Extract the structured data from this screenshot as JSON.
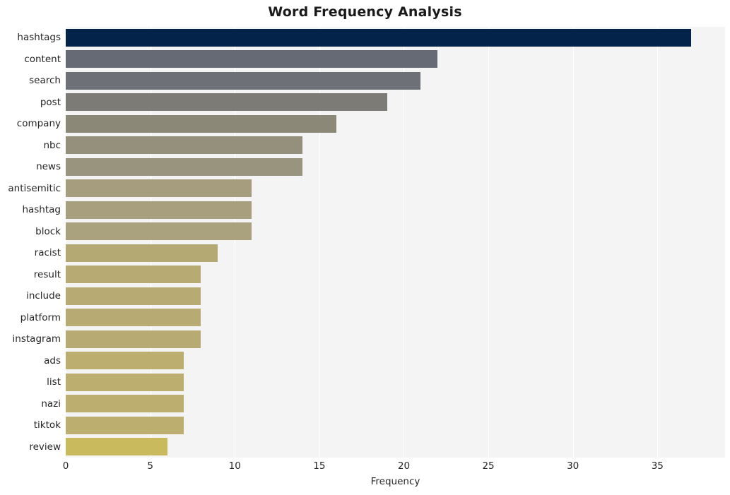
{
  "chart_data": {
    "type": "bar",
    "orientation": "horizontal",
    "title": "Word Frequency Analysis",
    "xlabel": "Frequency",
    "ylabel": "",
    "xlim": [
      0,
      39
    ],
    "xticks": [
      0,
      5,
      10,
      15,
      20,
      25,
      30,
      35
    ],
    "xtick_labels": [
      "0",
      "5",
      "10",
      "15",
      "20",
      "25",
      "30",
      "35"
    ],
    "grid": "vertical-only",
    "legend": "none",
    "categories": [
      "hashtags",
      "content",
      "search",
      "post",
      "company",
      "nbc",
      "news",
      "antisemitic",
      "hashtag",
      "block",
      "racist",
      "result",
      "include",
      "platform",
      "instagram",
      "ads",
      "list",
      "nazi",
      "tiktok",
      "review"
    ],
    "values": [
      37,
      22,
      21,
      19,
      16,
      14,
      14,
      11,
      11,
      11,
      9,
      8,
      8,
      8,
      8,
      7,
      7,
      7,
      7,
      6
    ],
    "bar_colors": [
      "#03234b",
      "#666a75",
      "#6e7077",
      "#7c7b76",
      "#8b8878",
      "#95907c",
      "#98947e",
      "#a69d7e",
      "#a89f7e",
      "#aaa17e",
      "#b4a873",
      "#b7aa72",
      "#b7aa72",
      "#b7aa72",
      "#b7aa72",
      "#bbae6e",
      "#bbae6e",
      "#bbae6e",
      "#bbae6e",
      "#c9ba5e"
    ],
    "colormap": "cividis",
    "plot_background": "#f4f4f5",
    "grid_color": "#ffffff",
    "figure_background": "#ffffff",
    "text_color": "#262626"
  }
}
